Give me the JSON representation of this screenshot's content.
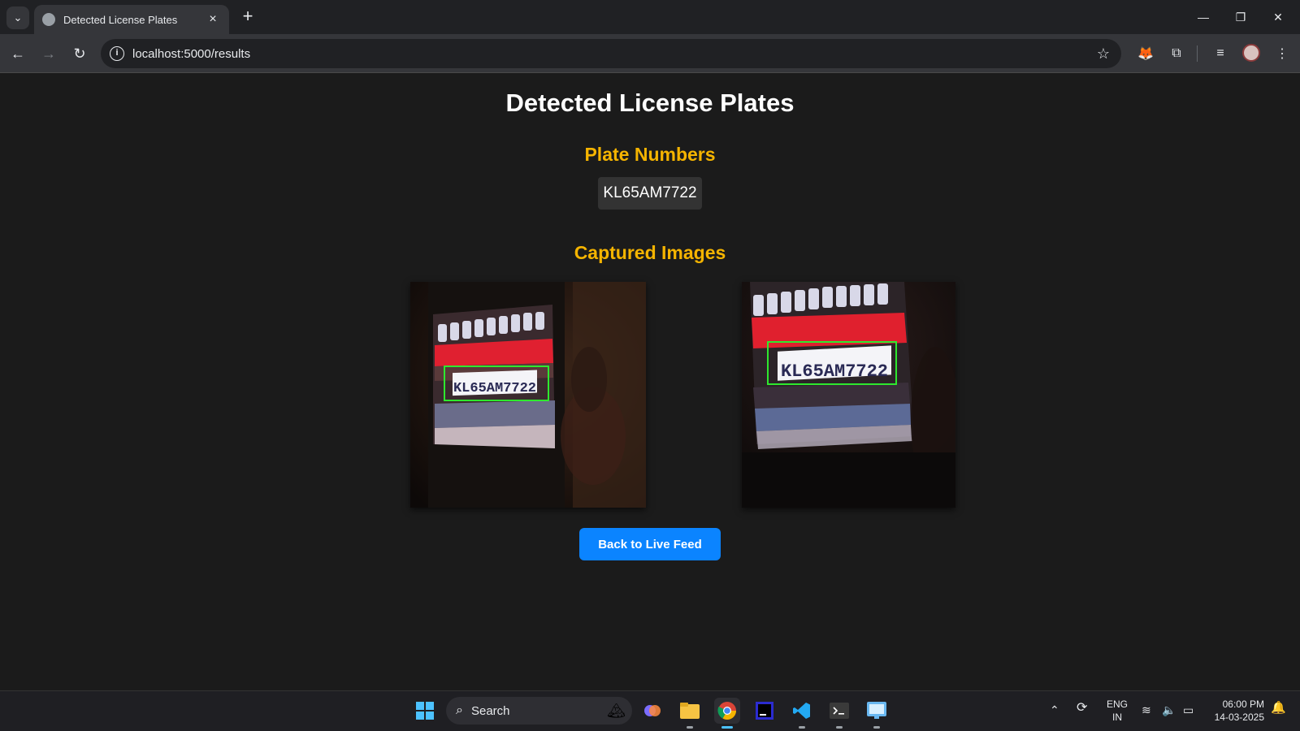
{
  "browser": {
    "tab_title": "Detected License Plates",
    "url": "localhost:5000/results"
  },
  "page": {
    "title": "Detected License Plates",
    "plates_heading": "Plate Numbers",
    "plates": [
      "KL65AM7722"
    ],
    "images_heading": "Captured Images",
    "captures": [
      {
        "plate_text": "KL65AM7722"
      },
      {
        "plate_text": "KL65AM7722"
      }
    ],
    "back_button": "Back to Live Feed"
  },
  "taskbar": {
    "search_placeholder": "Search",
    "lang_line1": "ENG",
    "lang_line2": "IN",
    "time": "06:00 PM",
    "date": "14-03-2025"
  },
  "colors": {
    "heading_accent": "#f5b400",
    "button": "#0b84ff",
    "detection_box": "#2ee82e"
  }
}
